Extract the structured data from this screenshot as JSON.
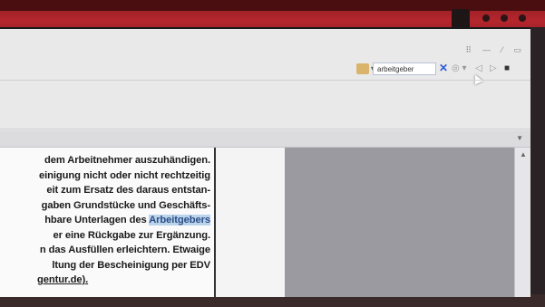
{
  "toolbar": {
    "search_value": "arbeitgeber",
    "clear_symbol": "✕",
    "prev_symbol": "◁",
    "next_symbol": "▷",
    "options_symbol": "◎ ▾",
    "bookmark_symbol": "▾"
  },
  "window_controls": {
    "grid": "⠿",
    "minimize": "—",
    "pin": "⁄",
    "close": "▭"
  },
  "document": {
    "lines": [
      {
        "text": "dem Arbeitnehmer auszuhändigen."
      },
      {
        "text": "einigung nicht oder nicht rechtzeitig"
      },
      {
        "text": "eit zum Ersatz des daraus entstan-"
      },
      {
        "text": "gaben Grundstücke und Geschäfts-"
      },
      {
        "pre": "hbare Unterlagen des ",
        "highlight": "Arbeitgebers"
      },
      {
        "text": "er eine Rückgabe zur Ergänzung."
      },
      {
        "text": "n das Ausfüllen erleichtern. Etwaige"
      },
      {
        "text": "ltung der Bescheinigung per EDV"
      },
      {
        "text": "gentur.de)."
      }
    ]
  },
  "colors": {
    "frame": "#b3262c",
    "highlight": "#bcd3ec",
    "screen": "#e9e9ea"
  }
}
